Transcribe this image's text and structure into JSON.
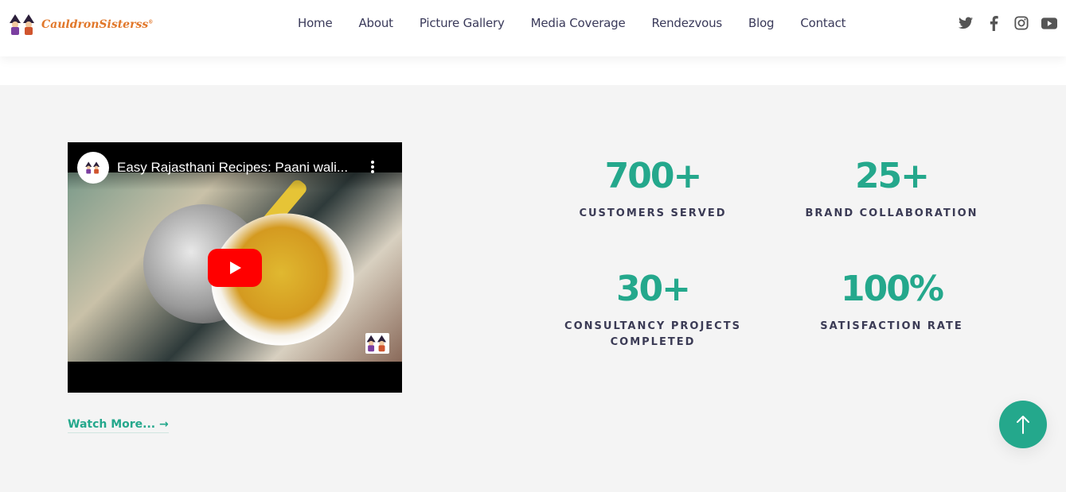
{
  "brand": {
    "name": "CauldronSisterss",
    "trademark": "®"
  },
  "nav": {
    "items": [
      "Home",
      "About",
      "Picture Gallery",
      "Media Coverage",
      "Rendezvous",
      "Blog",
      "Contact"
    ]
  },
  "social": {
    "icons": [
      "twitter-icon",
      "facebook-icon",
      "instagram-icon",
      "youtube-icon"
    ]
  },
  "video": {
    "title": "Easy Rajasthani Recipes: Paani wali...",
    "play_icon": "play-icon",
    "menu_icon": "more-vert-icon"
  },
  "watch_more": {
    "label": "Watch More...",
    "arrow": "→"
  },
  "stats": [
    {
      "value": "700+",
      "label": "CUSTOMERS SERVED"
    },
    {
      "value": "25+",
      "label": "BRAND COLLABORATION"
    },
    {
      "value": "30+",
      "label": "CONSULTANCY PROJECTS COMPLETED"
    },
    {
      "value": "100%",
      "label": "SATISFACTION RATE"
    }
  ],
  "scroll_top": {
    "icon": "arrow-up-icon"
  },
  "colors": {
    "accent": "#24a88c",
    "text_dark": "#3b3b55",
    "brand_orange": "#e1772a",
    "section_bg": "#f4f4f4",
    "youtube_red": "#ff0000"
  }
}
